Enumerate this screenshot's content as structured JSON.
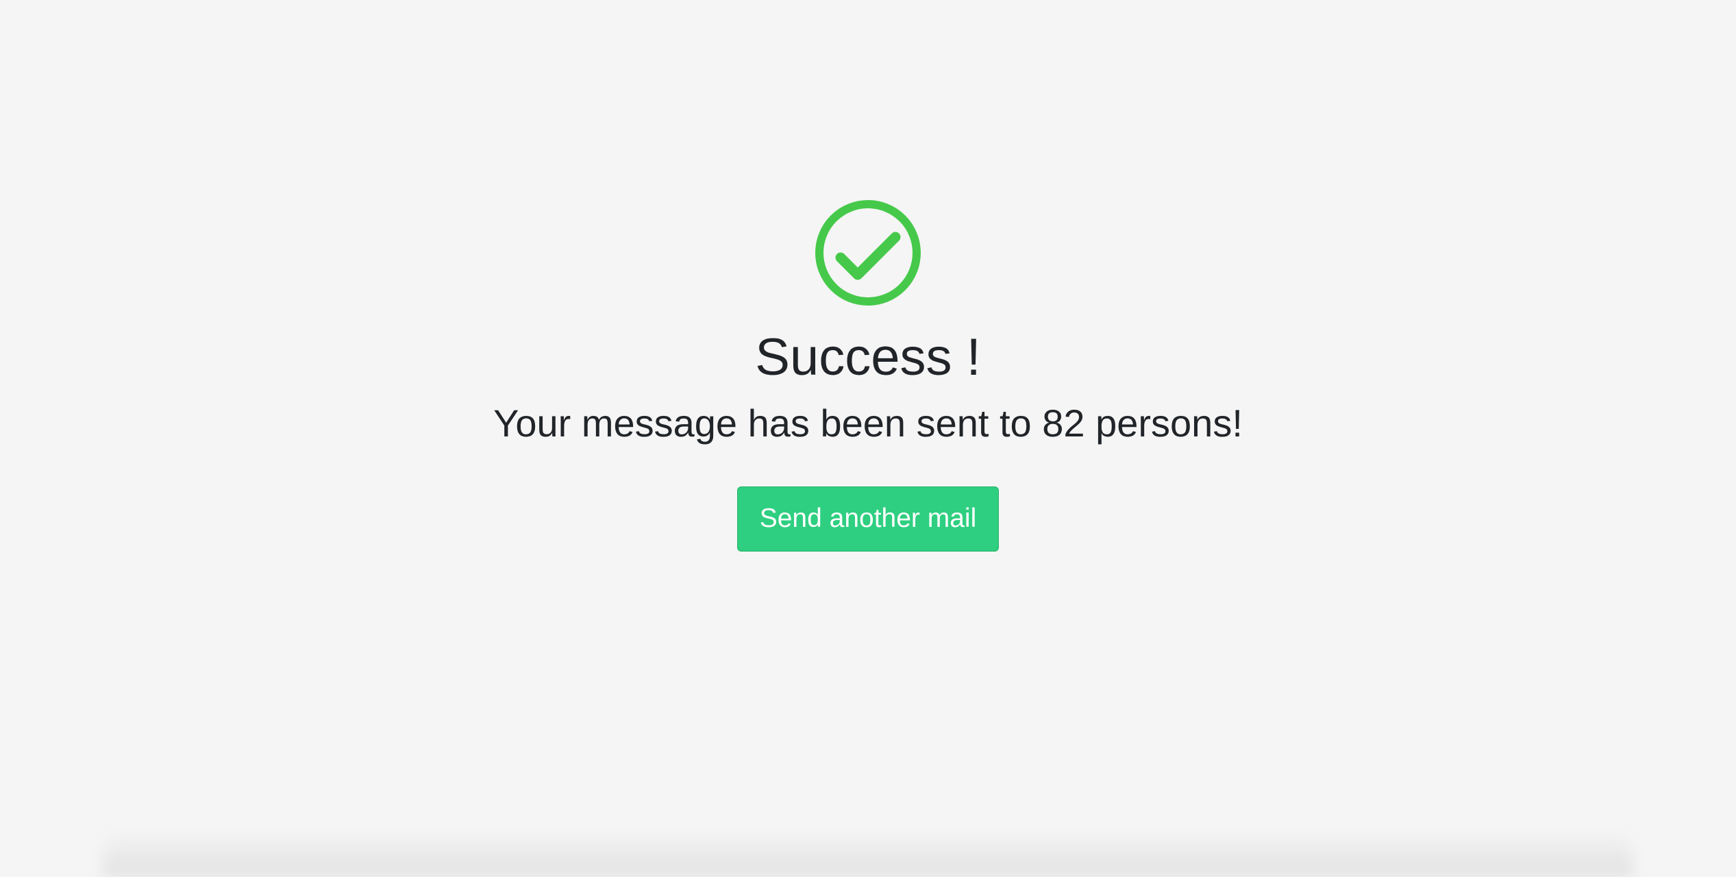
{
  "colors": {
    "background": "#f5f5f5",
    "success_green": "#46c94a",
    "button_green": "#2ecf80",
    "text": "#212529"
  },
  "icon": "check-circle-icon",
  "title": "Success !",
  "message": "Your message has been sent to 82 persons!",
  "button": {
    "label": "Send another mail"
  }
}
